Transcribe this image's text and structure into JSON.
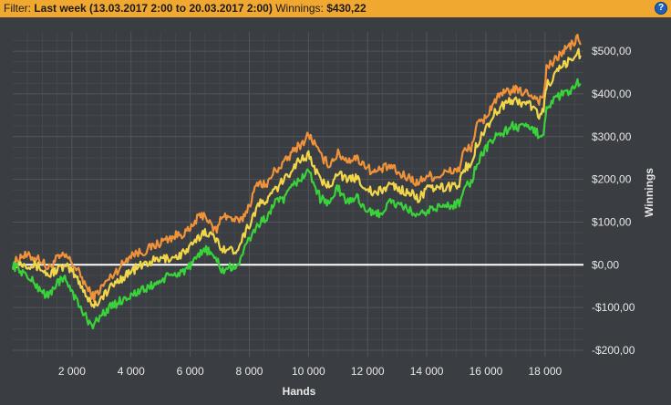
{
  "filter_bar": {
    "filter_label": "Filter:",
    "filter_value": "Last week (13.03.2017 2:00 to 20.03.2017 2:00)",
    "winnings_label": "Winnings:",
    "winnings_value": "$430,22",
    "help_icon": "help-icon",
    "help_symbol": "?"
  },
  "colors": {
    "background": "#3a3d42",
    "filter_bar": "#f0a830",
    "grid": "#52565c",
    "axis_text": "#e8e8e8",
    "zero_line": "#ffffff"
  },
  "chart_data": {
    "type": "line",
    "xlabel": "Hands",
    "ylabel": "Winnings",
    "xlim": [
      0,
      19300
    ],
    "ylim": [
      -215,
      545
    ],
    "x_ticks": [
      2000,
      4000,
      6000,
      8000,
      10000,
      12000,
      14000,
      16000,
      18000
    ],
    "x_tick_labels": [
      "2 000",
      "4 000",
      "6 000",
      "8 000",
      "10 000",
      "12 000",
      "14 000",
      "16 000",
      "18 000"
    ],
    "y_ticks": [
      -200,
      -100,
      0,
      100,
      200,
      300,
      400,
      500
    ],
    "y_tick_labels": [
      "-$200,00",
      "-$100,00",
      "$0,00",
      "$100,00",
      "$200,00",
      "$300,00",
      "$400,00",
      "$500,00"
    ],
    "grid": true,
    "zero_line": true,
    "series": [
      {
        "color": "#f0923a",
        "points": [
          [
            0,
            0
          ],
          [
            300,
            22
          ],
          [
            900,
            15
          ],
          [
            1200,
            -10
          ],
          [
            1500,
            15
          ],
          [
            1800,
            20
          ],
          [
            2000,
            5
          ],
          [
            2300,
            -25
          ],
          [
            2550,
            -60
          ],
          [
            2750,
            -75
          ],
          [
            3100,
            -45
          ],
          [
            3500,
            -15
          ],
          [
            4000,
            25
          ],
          [
            4400,
            30
          ],
          [
            4800,
            45
          ],
          [
            5200,
            60
          ],
          [
            5600,
            70
          ],
          [
            6000,
            80
          ],
          [
            6200,
            105
          ],
          [
            6500,
            120
          ],
          [
            6700,
            90
          ],
          [
            6900,
            80
          ],
          [
            7100,
            120
          ],
          [
            7300,
            110
          ],
          [
            7500,
            105
          ],
          [
            7700,
            100
          ],
          [
            8000,
            140
          ],
          [
            8300,
            195
          ],
          [
            8600,
            185
          ],
          [
            8800,
            215
          ],
          [
            9200,
            240
          ],
          [
            9600,
            275
          ],
          [
            9800,
            285
          ],
          [
            10000,
            305
          ],
          [
            10200,
            285
          ],
          [
            10400,
            255
          ],
          [
            10700,
            235
          ],
          [
            11000,
            260
          ],
          [
            11300,
            245
          ],
          [
            11600,
            250
          ],
          [
            11900,
            235
          ],
          [
            12200,
            215
          ],
          [
            12500,
            225
          ],
          [
            12800,
            230
          ],
          [
            13100,
            210
          ],
          [
            13400,
            205
          ],
          [
            13700,
            190
          ],
          [
            14000,
            210
          ],
          [
            14300,
            205
          ],
          [
            14600,
            215
          ],
          [
            14900,
            220
          ],
          [
            15100,
            225
          ],
          [
            15250,
            265
          ],
          [
            15500,
            275
          ],
          [
            15700,
            325
          ],
          [
            16000,
            345
          ],
          [
            16300,
            385
          ],
          [
            16600,
            400
          ],
          [
            16900,
            410
          ],
          [
            17200,
            405
          ],
          [
            17500,
            400
          ],
          [
            17800,
            385
          ],
          [
            17950,
            395
          ],
          [
            18050,
            460
          ],
          [
            18300,
            475
          ],
          [
            18600,
            500
          ],
          [
            18900,
            515
          ],
          [
            19100,
            530
          ],
          [
            19200,
            515
          ]
        ]
      },
      {
        "color": "#f2d64a",
        "points": [
          [
            0,
            0
          ],
          [
            300,
            5
          ],
          [
            900,
            -5
          ],
          [
            1200,
            -25
          ],
          [
            1500,
            -10
          ],
          [
            1800,
            -5
          ],
          [
            2000,
            -15
          ],
          [
            2300,
            -45
          ],
          [
            2550,
            -80
          ],
          [
            2750,
            -95
          ],
          [
            3100,
            -70
          ],
          [
            3500,
            -40
          ],
          [
            4000,
            -15
          ],
          [
            4400,
            0
          ],
          [
            4800,
            10
          ],
          [
            5200,
            15
          ],
          [
            5600,
            20
          ],
          [
            6000,
            40
          ],
          [
            6200,
            55
          ],
          [
            6500,
            80
          ],
          [
            6700,
            70
          ],
          [
            6900,
            55
          ],
          [
            7100,
            40
          ],
          [
            7300,
            35
          ],
          [
            7500,
            30
          ],
          [
            7700,
            55
          ],
          [
            8000,
            95
          ],
          [
            8300,
            140
          ],
          [
            8600,
            150
          ],
          [
            8800,
            170
          ],
          [
            9200,
            200
          ],
          [
            9600,
            240
          ],
          [
            9800,
            250
          ],
          [
            10000,
            255
          ],
          [
            10200,
            230
          ],
          [
            10400,
            195
          ],
          [
            10700,
            185
          ],
          [
            11000,
            220
          ],
          [
            11300,
            195
          ],
          [
            11600,
            205
          ],
          [
            11900,
            185
          ],
          [
            12200,
            165
          ],
          [
            12500,
            175
          ],
          [
            12800,
            190
          ],
          [
            13100,
            175
          ],
          [
            13400,
            170
          ],
          [
            13700,
            155
          ],
          [
            14000,
            175
          ],
          [
            14300,
            180
          ],
          [
            14600,
            180
          ],
          [
            14900,
            185
          ],
          [
            15100,
            190
          ],
          [
            15250,
            225
          ],
          [
            15500,
            235
          ],
          [
            15700,
            285
          ],
          [
            16000,
            320
          ],
          [
            16300,
            355
          ],
          [
            16600,
            375
          ],
          [
            16900,
            385
          ],
          [
            17200,
            380
          ],
          [
            17500,
            375
          ],
          [
            17800,
            350
          ],
          [
            17950,
            360
          ],
          [
            18050,
            420
          ],
          [
            18300,
            440
          ],
          [
            18600,
            465
          ],
          [
            18900,
            480
          ],
          [
            19100,
            500
          ],
          [
            19200,
            490
          ]
        ]
      },
      {
        "color": "#3ad23a",
        "points": [
          [
            0,
            0
          ],
          [
            300,
            -15
          ],
          [
            900,
            -55
          ],
          [
            1200,
            -75
          ],
          [
            1500,
            -40
          ],
          [
            1800,
            -35
          ],
          [
            2000,
            -60
          ],
          [
            2300,
            -105
          ],
          [
            2550,
            -130
          ],
          [
            2750,
            -140
          ],
          [
            3100,
            -110
          ],
          [
            3500,
            -90
          ],
          [
            4000,
            -70
          ],
          [
            4400,
            -60
          ],
          [
            4800,
            -45
          ],
          [
            5200,
            -30
          ],
          [
            5600,
            -20
          ],
          [
            6000,
            -5
          ],
          [
            6200,
            10
          ],
          [
            6500,
            40
          ],
          [
            6700,
            25
          ],
          [
            6900,
            10
          ],
          [
            7100,
            -15
          ],
          [
            7300,
            -5
          ],
          [
            7500,
            -10
          ],
          [
            7700,
            15
          ],
          [
            8000,
            60
          ],
          [
            8300,
            95
          ],
          [
            8600,
            110
          ],
          [
            8800,
            140
          ],
          [
            9200,
            155
          ],
          [
            9600,
            195
          ],
          [
            9800,
            205
          ],
          [
            10000,
            220
          ],
          [
            10200,
            190
          ],
          [
            10400,
            155
          ],
          [
            10700,
            145
          ],
          [
            11000,
            180
          ],
          [
            11300,
            145
          ],
          [
            11600,
            160
          ],
          [
            11900,
            135
          ],
          [
            12200,
            115
          ],
          [
            12500,
            125
          ],
          [
            12800,
            150
          ],
          [
            13100,
            135
          ],
          [
            13400,
            130
          ],
          [
            13700,
            110
          ],
          [
            14000,
            125
          ],
          [
            14300,
            135
          ],
          [
            14600,
            135
          ],
          [
            14900,
            140
          ],
          [
            15100,
            145
          ],
          [
            15250,
            185
          ],
          [
            15500,
            190
          ],
          [
            15700,
            240
          ],
          [
            16000,
            270
          ],
          [
            16300,
            300
          ],
          [
            16600,
            310
          ],
          [
            16900,
            325
          ],
          [
            17200,
            320
          ],
          [
            17500,
            320
          ],
          [
            17800,
            305
          ],
          [
            17950,
            310
          ],
          [
            18050,
            370
          ],
          [
            18300,
            385
          ],
          [
            18600,
            400
          ],
          [
            18900,
            405
          ],
          [
            19100,
            425
          ],
          [
            19200,
            420
          ]
        ]
      }
    ]
  }
}
